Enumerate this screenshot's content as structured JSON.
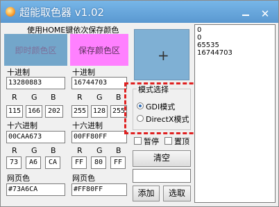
{
  "window": {
    "title": "超能取色器 v1.02",
    "icon": "color-picker-app-icon",
    "minimize_symbol": "",
    "close_symbol": "✕"
  },
  "header_label": "使用HOME键依次保存颜色",
  "swatches": {
    "current_label": "即时颜色区",
    "current_color": "#73A6CA",
    "saved_label": "保存颜色区",
    "saved_color": "#FF80FF"
  },
  "left": {
    "decimal_label": "十进制",
    "decimal_value": "13280883",
    "r_label": "R",
    "g_label": "G",
    "b_label": "B",
    "r": "115",
    "g": "166",
    "b": "202",
    "hex_label": "十六进制",
    "hex_value": "00CAA673",
    "hex_r_label": "R",
    "hex_g_label": "G",
    "hex_b_label": "B",
    "hex_r": "73",
    "hex_g": "A6",
    "hex_b": "CA",
    "web_label": "网页色",
    "web_value": "#73A6CA"
  },
  "right": {
    "decimal_label": "十进制",
    "decimal_value": "16744703",
    "r_label": "R",
    "g_label": "G",
    "b_label": "B",
    "r": "255",
    "g": "128",
    "b": "255",
    "hex_label": "十六进制",
    "hex_value": "00FF80FF",
    "hex_r_label": "R",
    "hex_g_label": "G",
    "hex_b_label": "B",
    "hex_r": "FF",
    "hex_g": "80",
    "hex_b": "FF",
    "web_label": "网页色",
    "web_value": "#FF80FF"
  },
  "preview": {
    "crosshair": "+"
  },
  "mode": {
    "title": "模式选择",
    "gdi_label": "GDI模式",
    "directx_label": "DirectX模式",
    "selected": "GDI模式"
  },
  "options": {
    "pause_label": "暂停",
    "topmost_label": "置顶",
    "pause_checked": false,
    "topmost_checked": false
  },
  "buttons": {
    "clear": "清空",
    "add": "添加",
    "pick": "选取"
  },
  "history": [
    "0",
    "0",
    "65535",
    "16744703"
  ],
  "colors": {
    "highlight_border": "#E02020",
    "title_bar": "#5A98D0"
  }
}
